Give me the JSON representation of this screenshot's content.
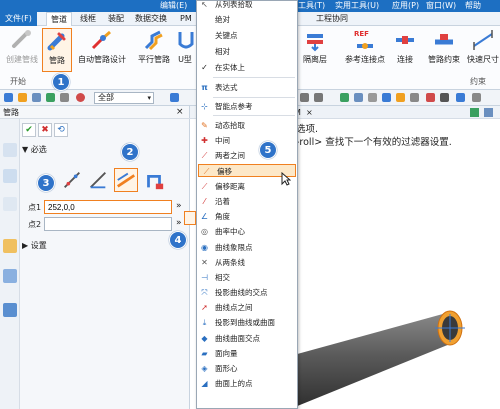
{
  "topmenu": {
    "items": [
      "从列表拾取",
      "工具(T)",
      "实用工具(U)",
      "应用(P)",
      "窗口(W)",
      "帮助"
    ],
    "left_text": "编辑(E)"
  },
  "ribbon_tabs": [
    "文件(F)",
    "管道",
    "线框",
    "装配",
    "数据交换",
    "PM",
    "工程协同"
  ],
  "ribbon": {
    "buttons": [
      {
        "label": "创建管线",
        "dim": true
      },
      {
        "label": "管路",
        "dim": false
      },
      {
        "label": "自动管路设计",
        "dim": false
      },
      {
        "label": "平行管路",
        "dim": false
      },
      {
        "label": "U型",
        "dim": false
      },
      {
        "label": "隔离层",
        "dim": false
      },
      {
        "label": "参考连接点",
        "dim": false
      },
      {
        "label": "连接",
        "dim": false
      },
      {
        "label": "管路约束",
        "dim": false
      },
      {
        "label": "快速尺寸",
        "dim": false
      }
    ],
    "ref_badge": "REF",
    "groups": [
      "开始",
      "约束"
    ]
  },
  "toolbar": {
    "filter_value": "全部"
  },
  "panel": {
    "title": "管路",
    "close": "×",
    "section_required": "必选",
    "section_settings": "设置",
    "point1_label": "点1",
    "point1_value": "252,0,0",
    "point2_label": "点2",
    "point2_value": ""
  },
  "canvas": {
    "tab_label": "M",
    "hint_line1": "选项.",
    "hint_line2": "-roll> 查找下一个有效的过滤器设置."
  },
  "menu": {
    "items": [
      {
        "label": "从列表拾取",
        "icon": "cursor-icon"
      },
      {
        "label": "绝对",
        "icon": ""
      },
      {
        "label": "关键点",
        "icon": ""
      },
      {
        "label": "相对",
        "icon": ""
      },
      {
        "label": "在实体上",
        "icon": "checkmark-icon"
      },
      {
        "label": "表达式",
        "icon": "pi-icon"
      },
      {
        "label": "智能点参考",
        "icon": "smart-point-icon"
      },
      {
        "label": "动态拾取",
        "icon": "dynamic-pick-icon"
      },
      {
        "label": "中间",
        "icon": "midpoint-icon"
      },
      {
        "label": "两者之间",
        "icon": "between-icon"
      },
      {
        "label": "偏移",
        "icon": "offset-icon"
      },
      {
        "label": "偏移距离",
        "icon": "offset-distance-icon"
      },
      {
        "label": "沿着",
        "icon": "along-icon"
      },
      {
        "label": "角度",
        "icon": "angle-icon"
      },
      {
        "label": "曲率中心",
        "icon": "curvature-center-icon"
      },
      {
        "label": "曲线象限点",
        "icon": "quadrant-icon"
      },
      {
        "label": "从两条线",
        "icon": "two-lines-icon"
      },
      {
        "label": "相交",
        "icon": "intersect-icon"
      },
      {
        "label": "投影曲线的交点",
        "icon": "project-intersect-icon"
      },
      {
        "label": "曲线点之间",
        "icon": "between-curve-points-icon"
      },
      {
        "label": "投影到曲线或曲面",
        "icon": "project-to-icon"
      },
      {
        "label": "曲线曲面交点",
        "icon": "curve-surface-intersect-icon"
      },
      {
        "label": "面向量",
        "icon": "face-vector-icon"
      },
      {
        "label": "面形心",
        "icon": "face-centroid-icon"
      },
      {
        "label": "曲面上的点",
        "icon": "point-on-surface-icon"
      }
    ]
  },
  "badges": [
    "1",
    "2",
    "3",
    "4",
    "5"
  ],
  "colors": {
    "accent": "#1d6fc2",
    "highlight": "#f08020",
    "badge": "#2f73c9",
    "highlight_fill": "#fde8c8"
  }
}
